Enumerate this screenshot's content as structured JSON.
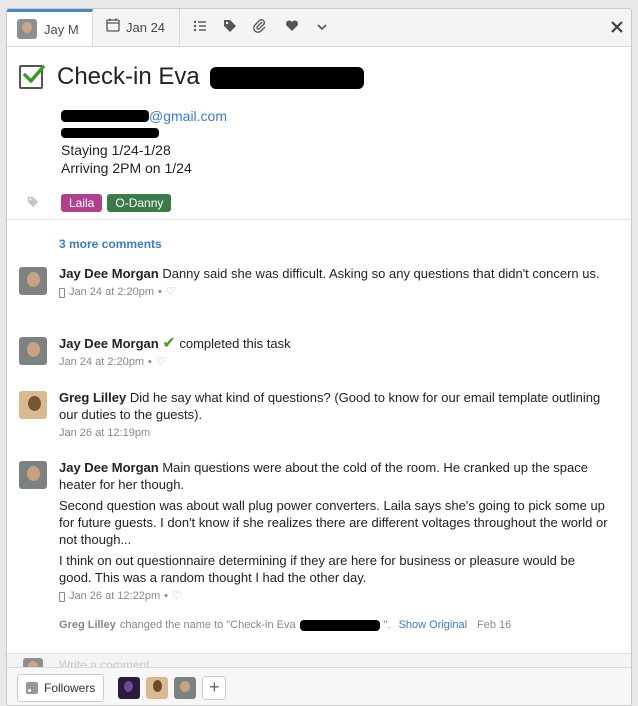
{
  "header": {
    "assignee": "Jay M",
    "due_date": "Jan 24",
    "icons": [
      "subtasks-icon",
      "tag-icon",
      "attachment-icon",
      "heart-icon",
      "chevron-down-icon",
      "close-icon"
    ]
  },
  "task": {
    "title_visible": "Check-in Eva",
    "email_suffix": "@gmail.com",
    "desc_line3": "Staying 1/24-1/28",
    "desc_line4": "Arriving 2PM on 1/24",
    "tags": [
      "Laila",
      "O-Danny"
    ]
  },
  "more_comments": "3 more comments",
  "comments": [
    {
      "author": "Jay Dee Morgan",
      "text": "Danny said she was difficult. Asking so any questions that didn't concern us.",
      "time": "Jan 24 at 2:20pm"
    },
    {
      "author": "Jay Dee Morgan",
      "text": "completed this task",
      "time": "Jan 24 at 2:20pm"
    },
    {
      "author": "Greg Lilley",
      "text": "Did he say what kind of questions? (Good to know for our email template outlining our duties to the guests).",
      "time": "Jan 26 at 12:19pm"
    },
    {
      "author": "Jay Dee Morgan",
      "text": "Main questions were about the cold of the room. He cranked up the space heater for her though.",
      "p2": "Second question was about wall plug power converters. Laila says she's going to pick some up for future guests. I don't know if she realizes there are different voltages throughout the world or not though...",
      "p3": "I think on out questionnaire determining if they are here for business or pleasure would be good. This was a random thought I had the other day.",
      "time": "Jan 26 at 12:22pm"
    }
  ],
  "history": {
    "author": "Greg Lilley",
    "action": "changed the name to \"Check-in Eva",
    "action_end": "\".",
    "show_original": "Show Original",
    "date": "Feb 16"
  },
  "composer": {
    "placeholder": "Write a comment..."
  },
  "footer": {
    "followers_label": "Followers",
    "add_label": "+"
  }
}
